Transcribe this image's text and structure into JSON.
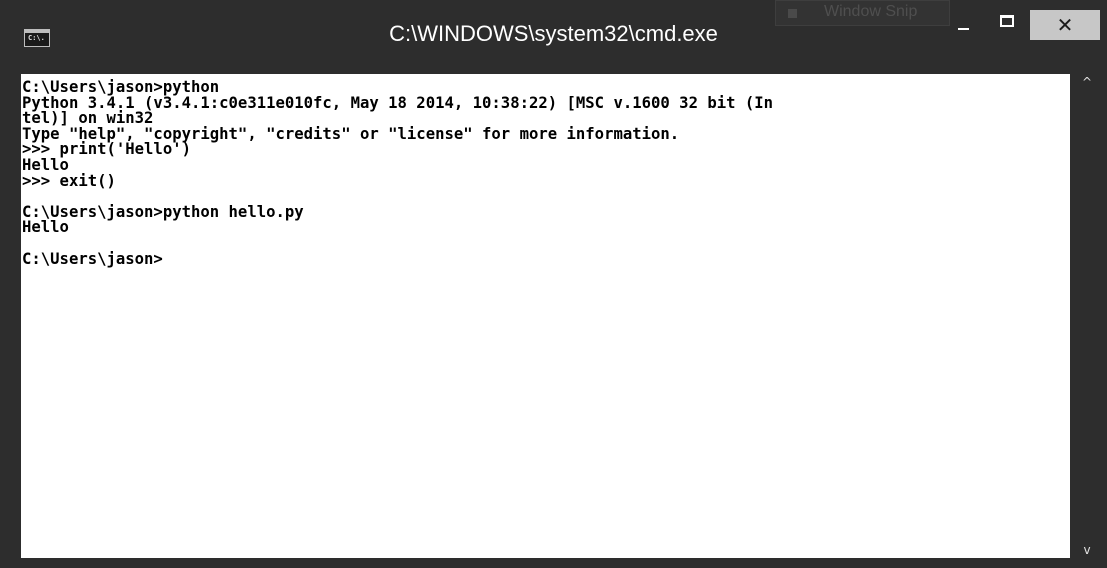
{
  "window": {
    "title": "C:\\WINDOWS\\system32\\cmd.exe",
    "icon": "cmd-icon",
    "icon_text": "C:\\.",
    "colors": {
      "frame": "#2d2d2d",
      "console_bg": "#ffffff",
      "console_text": "#000000",
      "close_button": "#c7c7c7"
    }
  },
  "snip_overlay": {
    "label": "Window Snip"
  },
  "controls": {
    "minimize_icon": "minimize-icon",
    "maximize_icon": "maximize-icon",
    "close_icon": "close-icon",
    "close_glyph": "✕"
  },
  "console": {
    "lines": [
      "C:\\Users\\jason>python",
      "Python 3.4.1 (v3.4.1:c0e311e010fc, May 18 2014, 10:38:22) [MSC v.1600 32 bit (In",
      "tel)] on win32",
      "Type \"help\", \"copyright\", \"credits\" or \"license\" for more information.",
      ">>> print('Hello')",
      "Hello",
      ">>> exit()",
      "",
      "C:\\Users\\jason>python hello.py",
      "Hello",
      "",
      "C:\\Users\\jason>"
    ]
  },
  "scrollbar": {
    "up_glyph": "^",
    "down_glyph": "v",
    "up_icon": "scroll-up-arrow-icon",
    "down_icon": "scroll-down-arrow-icon"
  }
}
